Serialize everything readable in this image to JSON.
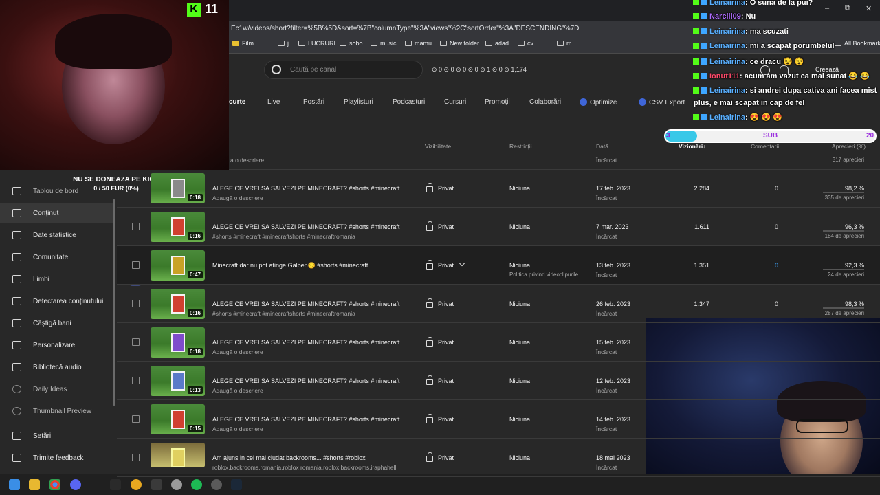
{
  "browser": {
    "url": "Ec1w/videos/short?filter=%5B%5D&sort=%7B\"columnType\"%3A\"views\"%2C\"sortOrder\"%3A\"DESCENDING\"%7D",
    "bookmarks": [
      "Film",
      "j",
      "LUCRURI",
      "sobo",
      "music",
      "mamu",
      "New folder",
      "adad",
      "cv",
      "m"
    ],
    "all_bookmarks": "All Bookmarks",
    "controls": {
      "minimize": "–",
      "restore": "⧉",
      "close": "✕"
    }
  },
  "studio": {
    "search_placeholder": "Caută pe canal",
    "stats_line": "⊙ 0  ⊙ 0  ⊙ 0  ⊙ 0  ⊙ 1  ⊙ 0  ⊙ 1,174",
    "create_label": "Creează",
    "tabs": [
      "curte",
      "Live",
      "Postări",
      "Playlisturi",
      "Podcasturi",
      "Cursuri",
      "Promoții",
      "Colaborări",
      "Optimize",
      "CSV Export"
    ],
    "columns": {
      "visibility": "Vizibilitate",
      "restrictions": "Restricții",
      "date": "Dată",
      "views": "Vizionări",
      "sort_icon": "↓",
      "comments": "Comentarii",
      "likes": "Aprecieri (%)"
    },
    "partial_row": {
      "desc": "a o descriere",
      "date_sub": "Încărcat",
      "likes_sub": "317 aprecieri"
    }
  },
  "sidebar": {
    "items": [
      {
        "label": "Tablou de bord",
        "icon": "dashboard-icon"
      },
      {
        "label": "Conținut",
        "icon": "content-icon"
      },
      {
        "label": "Date statistice",
        "icon": "analytics-icon"
      },
      {
        "label": "Comunitate",
        "icon": "community-icon"
      },
      {
        "label": "Limbi",
        "icon": "subtitles-icon"
      },
      {
        "label": "Detectarea conținutului",
        "icon": "copyright-icon"
      },
      {
        "label": "Câștigă bani",
        "icon": "money-icon"
      },
      {
        "label": "Personalizare",
        "icon": "customize-icon"
      },
      {
        "label": "Bibliotecă audio",
        "icon": "audio-library-icon"
      },
      {
        "label": "Daily Ideas",
        "icon": "ideas-icon"
      },
      {
        "label": "Thumbnail Preview",
        "icon": "preview-icon"
      },
      {
        "label": "Setări",
        "icon": "settings-icon"
      },
      {
        "label": "Trimite feedback",
        "icon": "feedback-icon"
      }
    ]
  },
  "rows": [
    {
      "duration": "0:18",
      "title": "ALEGE CE VREI SA SALVEZI PE MINECRAFT? #shorts #minecraft",
      "desc": "Adaugă o descriere",
      "visibility": "Privat",
      "restriction": "Niciuna",
      "restriction_sub": "",
      "date": "17 feb. 2023",
      "date_sub": "Încărcat",
      "views": "2.284",
      "comments": "0",
      "likes": "98,2 %",
      "likes_sub": "335 de aprecieri"
    },
    {
      "duration": "0:16",
      "title": "ALEGE CE VREI SA SALVEZI PE MINECRAFT? #shorts #minecraft",
      "desc": "#shorts #minecraft #minecraftshorts #minecraftromania",
      "visibility": "Privat",
      "restriction": "Niciuna",
      "restriction_sub": "",
      "date": "7 mar. 2023",
      "date_sub": "Încărcat",
      "views": "1.611",
      "comments": "0",
      "likes": "96,3 %",
      "likes_sub": "184 de aprecieri"
    },
    {
      "duration": "0:47",
      "title": "Minecraft dar nu pot atinge Galben😏 #shorts #minecraft",
      "desc": "",
      "visibility": "Privat",
      "restriction": "Niciuna",
      "restriction_sub": "Politica privind videoclipurile...",
      "date": "13 feb. 2023",
      "date_sub": "Încărcat",
      "views": "1.351",
      "comments": "0",
      "likes": "92,3 %",
      "likes_sub": "24 de aprecieri"
    },
    {
      "duration": "0:16",
      "title": "ALEGE CE VREI SA SALVEZI PE MINECRAFT? #shorts #minecraft",
      "desc": "#shorts #minecraft #minecraftshorts #minecraftromania",
      "visibility": "Privat",
      "restriction": "Niciuna",
      "restriction_sub": "",
      "date": "26 feb. 2023",
      "date_sub": "Încărcat",
      "views": "1.347",
      "comments": "0",
      "likes": "98,3 %",
      "likes_sub": "287 de aprecieri"
    },
    {
      "duration": "0:18",
      "title": "ALEGE CE VREI SA SALVEZI PE MINECRAFT? #shorts #minecraft",
      "desc": "Adaugă o descriere",
      "visibility": "Privat",
      "restriction": "Niciuna",
      "restriction_sub": "",
      "date": "15 feb. 2023",
      "date_sub": "Încărcat",
      "views": "",
      "comments": "",
      "likes": "",
      "likes_sub": ""
    },
    {
      "duration": "0:13",
      "title": "ALEGE CE VREI SA SALVEZI PE MINECRAFT? #shorts #minecraft",
      "desc": "Adaugă o descriere",
      "visibility": "Privat",
      "restriction": "Niciuna",
      "restriction_sub": "",
      "date": "12 feb. 2023",
      "date_sub": "Încărcat",
      "views": "",
      "comments": "",
      "likes": "",
      "likes_sub": ""
    },
    {
      "duration": "0:15",
      "title": "ALEGE CE VREI SA SALVEZI PE MINECRAFT? #shorts #minecraft",
      "desc": "Adaugă o descriere",
      "visibility": "Privat",
      "restriction": "Niciuna",
      "restriction_sub": "",
      "date": "14 feb. 2023",
      "date_sub": "Încărcat",
      "views": "",
      "comments": "",
      "likes": "",
      "likes_sub": ""
    },
    {
      "duration": "",
      "title": "Am ajuns in cel mai ciudat backrooms... #shorts #roblox",
      "desc": "roblox,backrooms,romania,roblox romania,roblox backrooms,iraphahell",
      "visibility": "Privat",
      "restriction": "Niciuna",
      "restriction_sub": "",
      "date": "18 mai 2023",
      "date_sub": "Încărcat",
      "views": "",
      "comments": "",
      "likes": "",
      "likes_sub": ""
    }
  ],
  "stream": {
    "kick_count": "11",
    "kick_logo": "K",
    "donate_title": "NU SE DONEAZA PE KICK",
    "donate_progress": "0 / 50 EUR (0%)",
    "sub_current": "3",
    "sub_label": "SUB",
    "sub_goal": "20",
    "sub_fraction": 0.15,
    "chat": [
      {
        "user": "Leinairina",
        "text": ": O suna de la pui?"
      },
      {
        "user": "Narcili09",
        "text": ": Nu"
      },
      {
        "user": "Leinairina",
        "text": ": ma scuzati"
      },
      {
        "user": "Leinairina",
        "text": ": mi a scapat porumbelul"
      },
      {
        "user": "Leinairina",
        "text": ": ce dracu 😵 😵"
      },
      {
        "user": "Ionut111",
        "text": ": acum am vazut ca mai sunat 😂 😂"
      },
      {
        "user": "Leinairina",
        "text": ": si andrei dupa cativa ani facea mist"
      },
      {
        "user": "",
        "text": "plus, e mai scapat in cap de fel"
      },
      {
        "user": "Leinairina",
        "text": ": 😍 😍 😍"
      }
    ]
  },
  "colors": {
    "accent": "#3ea6ff",
    "kick_green": "#53fc18",
    "sub_purple": "#9c30e0",
    "sub_fill": "#38c8e8"
  }
}
